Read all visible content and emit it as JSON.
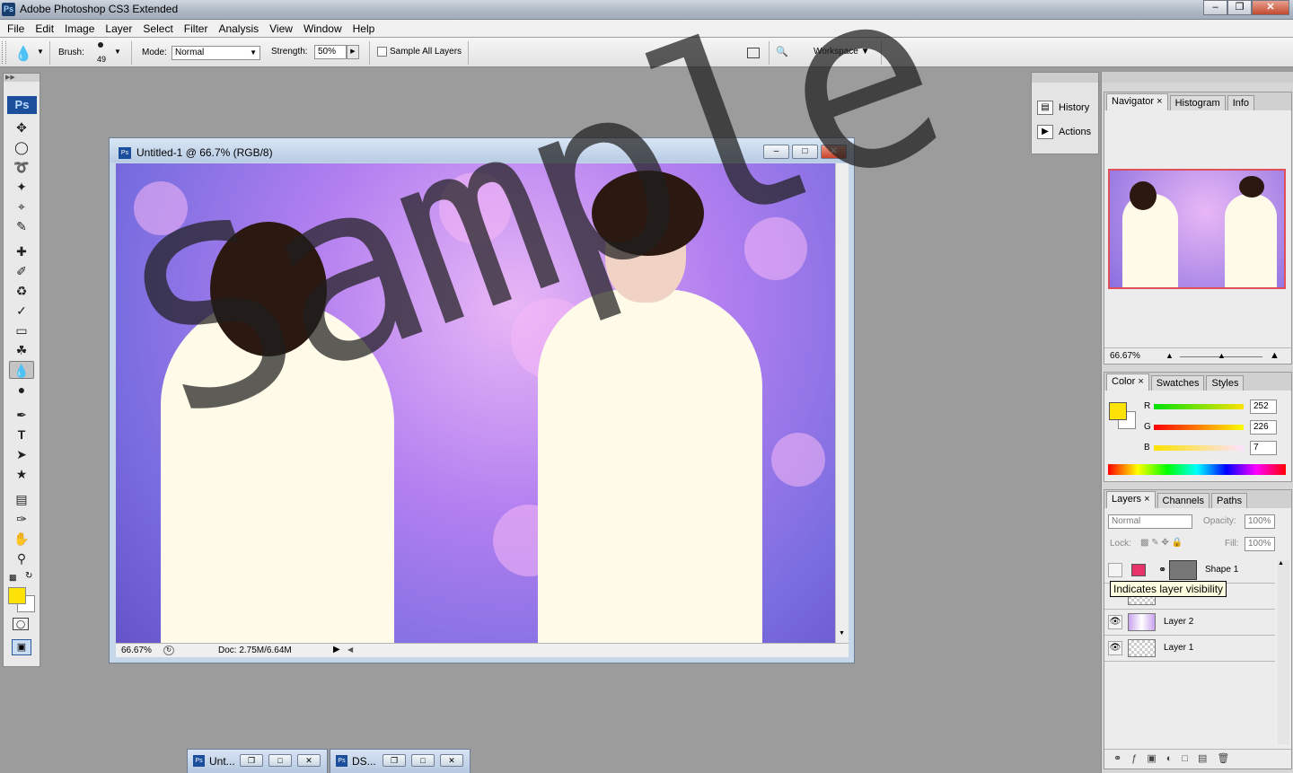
{
  "app": {
    "title": "Adobe Photoshop CS3 Extended",
    "icon_text": "Ps",
    "window_buttons": [
      "minimize-icon",
      "restore-icon",
      "close-icon"
    ]
  },
  "menu": [
    "File",
    "Edit",
    "Image",
    "Layer",
    "Select",
    "Filter",
    "Analysis",
    "View",
    "Window",
    "Help"
  ],
  "options": {
    "brush_label": "Brush:",
    "brush_size": "49",
    "mode_label": "Mode:",
    "mode_value": "Normal",
    "strength_label": "Strength:",
    "strength_value": "50%",
    "sample_all_layers": "Sample All Layers",
    "workspace": "Workspace"
  },
  "toolbox": {
    "logo": "Ps"
  },
  "document": {
    "title": "Untitled-1 @ 66.7% (RGB/8)",
    "zoom": "66.67%",
    "doc_size": "Doc: 2.75M/6.64M",
    "watermark": "Sample"
  },
  "mid_dock": {
    "history": "History",
    "actions": "Actions"
  },
  "navigator": {
    "tabs": [
      "Navigator",
      "Histogram",
      "Info"
    ],
    "zoom": "66.67%",
    "zoom_level": 0.5
  },
  "color_panel": {
    "tabs": [
      "Color",
      "Swatches",
      "Styles"
    ],
    "r_label": "R",
    "g_label": "G",
    "b_label": "B",
    "r": "252",
    "g": "226",
    "b": "7",
    "foreground": "#fce207",
    "background": "#ffffff"
  },
  "layers_panel": {
    "tabs": [
      "Layers",
      "Channels",
      "Paths"
    ],
    "blend": "Normal",
    "opacity_label": "Opacity:",
    "opacity": "100%",
    "lock_label": "Lock:",
    "fill_label": "Fill:",
    "fill": "100%",
    "layers": [
      {
        "name": "Shape 1",
        "visible": false
      },
      {
        "name": "Layer 2",
        "visible": true
      },
      {
        "name": "Layer 1",
        "visible": true
      }
    ],
    "tooltip": "Indicates layer visibility"
  },
  "minimized_docs": [
    {
      "title": "Unt..."
    },
    {
      "title": "DS..."
    }
  ]
}
